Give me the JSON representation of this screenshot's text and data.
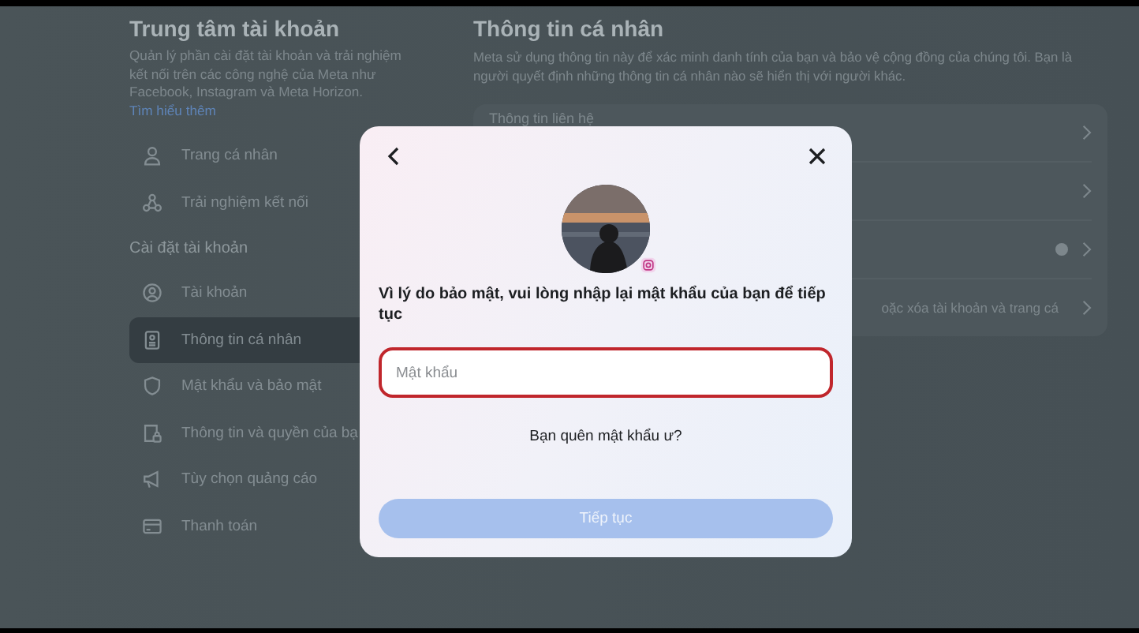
{
  "sidebar": {
    "title": "Trung tâm tài khoản",
    "description": "Quản lý phần cài đặt tài khoản và trải nghiệm kết nối trên các công nghệ của Meta như Facebook, Instagram và Meta Horizon.",
    "learn_more": "Tìm hiểu thêm",
    "items": [
      {
        "label": "Trang cá nhân",
        "selected": false
      },
      {
        "label": "Trải nghiệm kết nối",
        "selected": false
      }
    ],
    "section": "Cài đặt tài khoản",
    "settings": [
      {
        "label": "Tài khoản",
        "selected": false
      },
      {
        "label": "Thông tin cá nhân",
        "selected": true
      },
      {
        "label": "Mật khẩu và bảo mật",
        "selected": false
      },
      {
        "label": "Thông tin và quyền của bạ",
        "selected": false
      },
      {
        "label": "Tùy chọn quảng cáo",
        "selected": false
      },
      {
        "label": "Thanh toán",
        "selected": false
      }
    ]
  },
  "content": {
    "title": "Thông tin cá nhân",
    "description": "Meta sử dụng thông tin này để xác minh danh tính của bạn và bảo vệ cộng đồng của chúng tôi. Bạn là người quyết định những thông tin cá nhân nào sẽ hiển thị với người khác.",
    "rows": [
      {
        "kind": "text",
        "label": "Thông tin liên hệ"
      },
      {
        "kind": "blank"
      },
      {
        "kind": "badge"
      },
      {
        "kind": "partial",
        "label": "oặc xóa tài khoản và trang cá"
      }
    ]
  },
  "dialog": {
    "prompt": "Vì lý do bảo mật, vui lòng nhập lại mật khẩu của bạn để tiếp tục",
    "password": {
      "placeholder": "Mật khẩu",
      "focused": true
    },
    "forgot_link": "Bạn quên mật khẩu ư?",
    "continue_button": {
      "label": "Tiếp tục",
      "disabled": true
    }
  }
}
